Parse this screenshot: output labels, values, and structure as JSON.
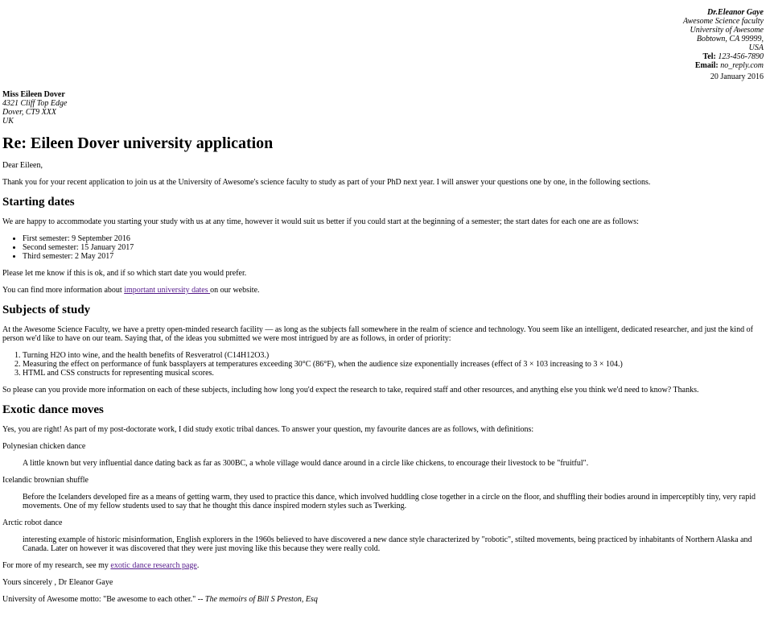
{
  "sender": {
    "name": "Dr.Eleanor Gaye",
    "faculty": "Awesome Science faculty",
    "university": "University of Awesome",
    "city": "Bobtown, CA 99999,",
    "country": "USA",
    "tel_label": "Tel:",
    "tel": "123-456-7890",
    "email_label": "Email:",
    "email": "no_reply.com",
    "date": "20 January 2016"
  },
  "recipient": {
    "name": "Miss Eileen Dover",
    "street": "4321 Cliff Top Edge",
    "city": "Dover, CT9 XXX",
    "country": "UK"
  },
  "title": "Re: Eileen Dover university application",
  "greeting": "Dear Eileen,",
  "intro": "Thank you for your recent application to join us at the University of Awesome's science faculty to study as part of your PhD next year. I will answer your questions one by one, in the following sections.",
  "starting": {
    "heading": "Starting dates",
    "text": "We are happy to accommodate you starting your study with us at any time, however it would suit us better if you could start at the beginning of a semester; the start dates for each one are as follows:",
    "items": [
      "First semester: 9 September 2016",
      "Second semester: 15 January 2017",
      "Third semester: 2 May 2017"
    ],
    "followup": "Please let me know if this is ok, and if so which start date you would prefer.",
    "more_before": "You can find more information about ",
    "more_link": "important university dates ",
    "more_after": "on our website."
  },
  "subjects": {
    "heading": "Subjects of study",
    "text": "At the Awesome Science Faculty, we have a pretty open-minded research facility — as long as the subjects fall somewhere in the realm of science and technology. You seem like an intelligent, dedicated researcher, and just the kind of person we'd like to have on our team. Saying that, of the ideas you submitted we were most intrigued by are as follows, in order of priority:",
    "items": [
      "Turning H2O into wine, and the health benefits of Resveratrol (C14H12O3.)",
      "Measuring the effect on performance of funk bassplayers at temperatures exceeding 30°C (86°F), when the audience size exponentially increases (effect of 3 × 103 increasing to 3 × 104.)",
      "HTML and CSS constructs for representing musical scores."
    ],
    "followup": "So please can you provide more information on each of these subjects, including how long you'd expect the research to take, required staff and other resources, and anything else you think we'd need to know? Thanks."
  },
  "dance": {
    "heading": "Exotic dance moves",
    "text": "Yes, you are right! As part of my post-doctorate work, I did study exotic tribal dances. To answer your question, my favourite dances are as follows, with definitions:",
    "terms": [
      {
        "term": "Polynesian chicken dance",
        "def": "A little known but very influential dance dating back as far as 300BC, a whole village would dance around in a circle like chickens, to encourage their livestock to be \"fruitful\"."
      },
      {
        "term": "Icelandic brownian shuffle",
        "def": "Before the Icelanders developed fire as a means of getting warm, they used to practice this dance, which involved huddling close together in a circle on the floor, and shuffling their bodies around in imperceptibly tiny, very rapid movements. One of my fellow students used to say that he thought this dance inspired modern styles such as Twerking."
      },
      {
        "term": "Arctic robot dance",
        "def": "interesting example of historic misinformation, English explorers in the 1960s believed to have discovered a new dance style characterized by \"robotic\", stilted movements, being practiced by inhabitants of Northern Alaska and Canada. Later on however it was discovered that they were just moving like this because they were really cold."
      }
    ],
    "more_before": "For more of my research, see my ",
    "more_link": "exotic dance research page",
    "more_after": "."
  },
  "closing": "Yours sincerely , Dr Eleanor Gaye",
  "motto_text": "University of Awesome motto: \"Be awesome to each other.\" -- ",
  "motto_cite": "The memoirs of Bill S Preston, Esq"
}
